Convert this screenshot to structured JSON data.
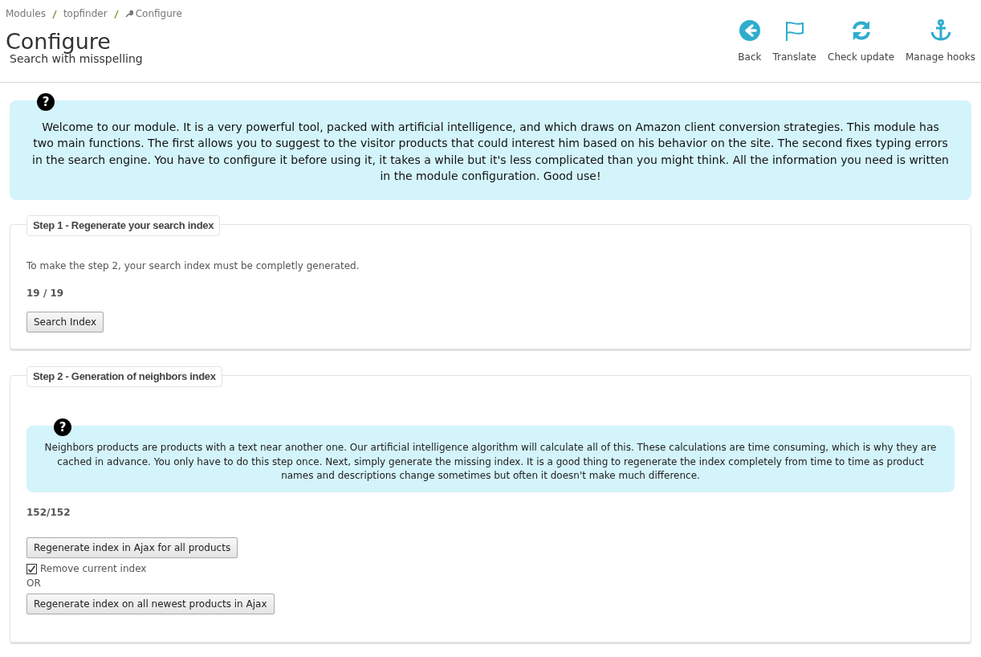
{
  "breadcrumb": [
    {
      "label": "Modules",
      "icon": false
    },
    {
      "label": "topfinder",
      "icon": false
    },
    {
      "label": "Configure",
      "icon": true
    }
  ],
  "page_title": "Configure",
  "subtitle": "Search with misspelling",
  "toolbar": [
    {
      "label": "Back",
      "kind": "back"
    },
    {
      "label": "Translate",
      "kind": "flag"
    },
    {
      "label": "Check update",
      "kind": "refresh"
    },
    {
      "label": "Manage hooks",
      "kind": "anchor"
    }
  ],
  "intro": {
    "help_mark": "?",
    "text": "Welcome to our module. It is a very powerful tool, packed with artificial intelligence, and which draws on Amazon client conversion strategies. This module has two main functions. The first allows you to suggest to the visitor products that could interest him based on his behavior on the site. The second fixes typing errors in the search engine. You have to configure it before using it, it takes a while but it's less complicated than you might think. All the information you need is written in the module configuration. Good use!"
  },
  "steps": [
    {
      "legend": "Step 1 - Regenerate your search index",
      "items": [
        {
          "kind": "text",
          "text": "To make the step 2, your search index must be completly generated."
        },
        {
          "kind": "count",
          "text": "19 / 19"
        },
        {
          "kind": "button",
          "text": "Search Index"
        }
      ]
    },
    {
      "legend": "Step 2 - Generation of neighbors index",
      "items": [
        {
          "kind": "info",
          "help_mark": "?",
          "text": "Neighbors products are products with a text near another one. Our artificial intelligence algorithm will calculate all of this. These calculations are time consuming, which is why they are cached in advance. You only have to do this step once. Next, simply generate the missing index. It is a good thing to regenerate the index completely from time to time as product names and descriptions change sometimes but often it doesn't make much difference."
        },
        {
          "kind": "count",
          "text": "152/152"
        },
        {
          "kind": "button",
          "text": "Regenerate index in Ajax for all products"
        },
        {
          "kind": "checkbox",
          "text": "Remove current index",
          "checked": true
        },
        {
          "kind": "or",
          "text": "OR"
        },
        {
          "kind": "button",
          "text": "Regenerate index on all newest products in Ajax"
        }
      ]
    }
  ]
}
